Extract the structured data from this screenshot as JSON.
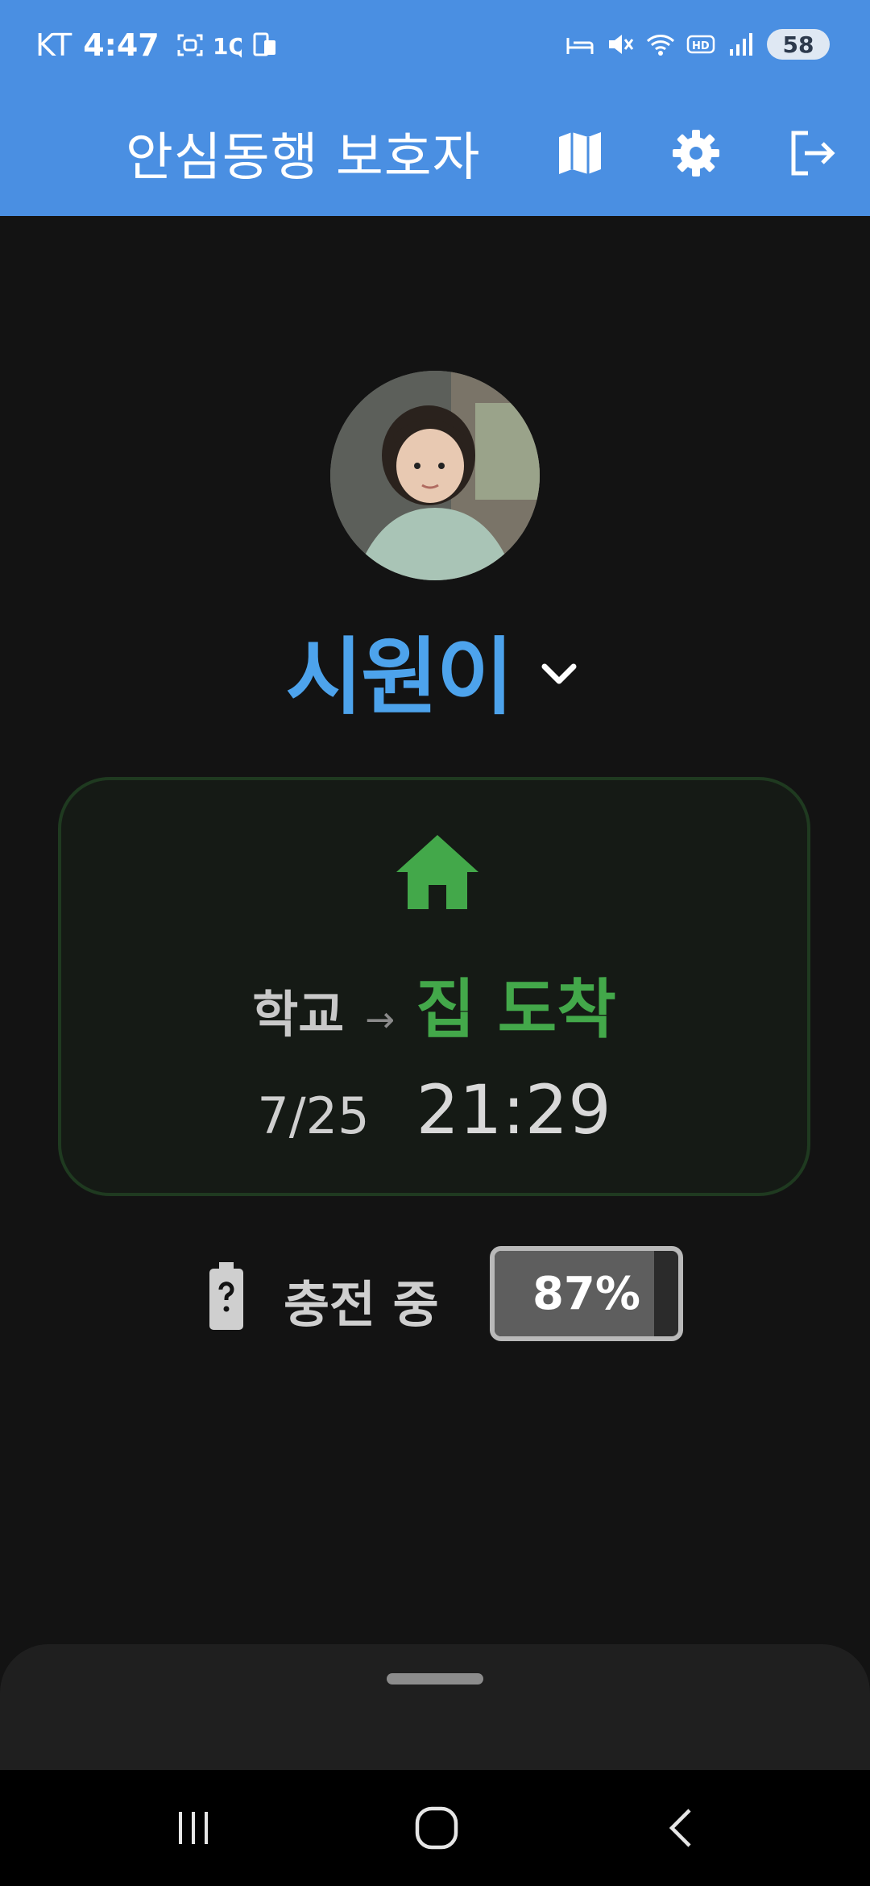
{
  "status_bar": {
    "carrier": "KT",
    "time": "4:47",
    "battery_level": "58",
    "icons": [
      "face-scan-icon",
      "1q-icon",
      "device-icon",
      "bed-icon",
      "mute-icon",
      "wifi-icon",
      "hd-icon",
      "signal-icon"
    ]
  },
  "app_bar": {
    "title": "안심동행 보호자",
    "actions": [
      "map-icon",
      "gear-icon",
      "logout-icon"
    ],
    "color": "#4a8fe2"
  },
  "profile": {
    "child_name": "시원이",
    "name_color": "#4da3ec"
  },
  "status_card": {
    "icon": "home-icon",
    "from": "학교",
    "arrow": "→",
    "to": "집 도착",
    "date": "7/25",
    "time": "21:29",
    "accent": "#43a84a"
  },
  "battery": {
    "label": "충전 중",
    "percent_text": "87%",
    "level": 87
  },
  "nav_bar": {
    "buttons": [
      "recents-icon",
      "home-button-icon",
      "back-icon"
    ]
  }
}
